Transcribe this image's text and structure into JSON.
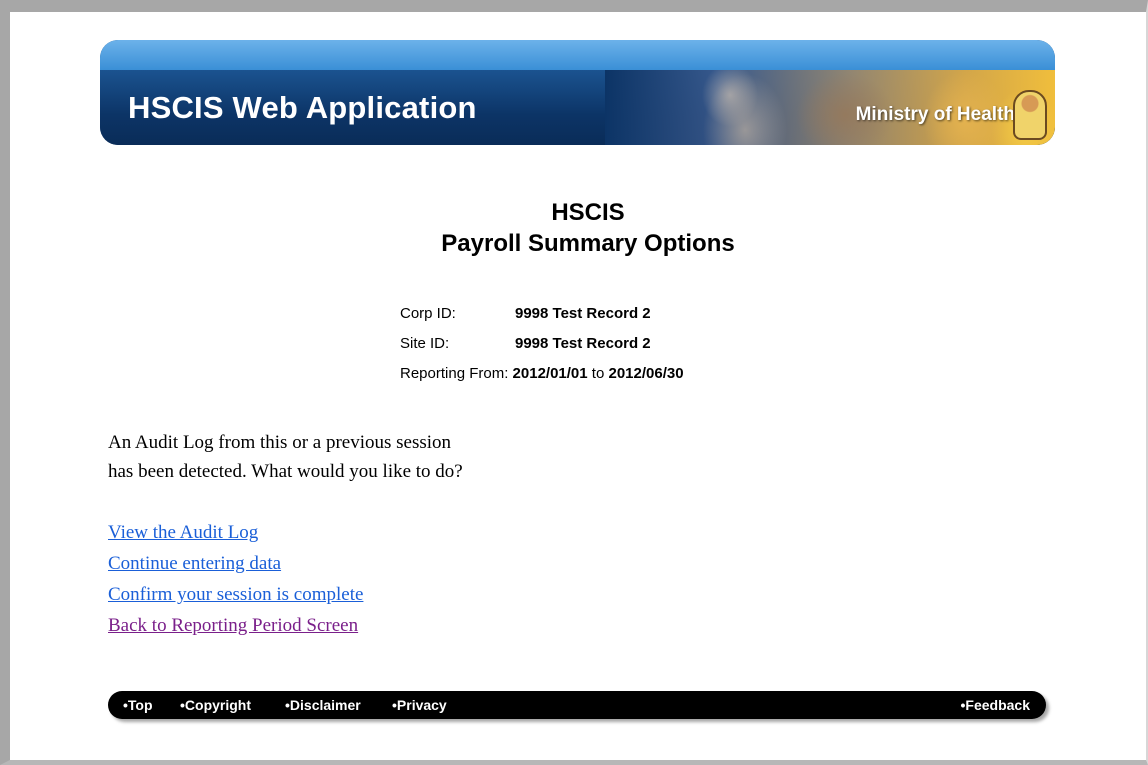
{
  "banner": {
    "title": "HSCIS Web Application",
    "ministry": "Ministry of Health"
  },
  "heading": {
    "line1": "HSCIS",
    "line2": "Payroll Summary Options"
  },
  "info": {
    "corp_label": "Corp ID:",
    "corp_value": "9998 Test Record 2",
    "site_label": "Site ID:",
    "site_value": "9998 Test Record 2",
    "reporting_label": "Reporting From:",
    "reporting_from": "2012/01/01",
    "reporting_to_word": "to",
    "reporting_to": "2012/06/30"
  },
  "message": {
    "line1": "An Audit Log from this or a previous session",
    "line2": "has been detected. What would you like to do?"
  },
  "links": {
    "view_audit_log": "View the Audit Log",
    "continue_entering": "Continue entering data",
    "confirm_complete": "Confirm your session is complete",
    "back_to_reporting": "Back to Reporting Period Screen"
  },
  "footer": {
    "top": "•Top",
    "copyright": "•Copyright",
    "disclaimer": "•Disclaimer",
    "privacy": "•Privacy",
    "feedback": "•Feedback"
  },
  "colors": {
    "link": "#1a5fd8",
    "visited_link": "#7a1f8a",
    "banner_dark": "#0c3466",
    "banner_light": "#6cb2ea"
  }
}
